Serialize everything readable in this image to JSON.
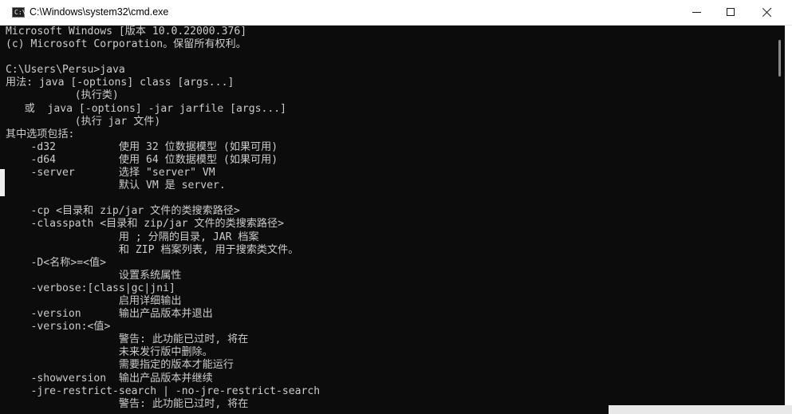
{
  "window": {
    "title": "C:\\Windows\\system32\\cmd.exe",
    "icon": "cmd-icon",
    "icon_prompt": "C:\\"
  },
  "controls": {
    "minimize": "minimize-icon",
    "maximize": "maximize-icon",
    "close": "close-icon"
  },
  "colors": {
    "console_bg": "#0c0c0c",
    "console_text": "#cccccc",
    "titlebar_bg": "#ffffff"
  },
  "console": {
    "lines": [
      "Microsoft Windows [版本 10.0.22000.376]",
      "(c) Microsoft Corporation。保留所有权利。",
      "",
      "C:\\Users\\Persu>java",
      "用法: java [-options] class [args...]",
      "           (执行类)",
      "   或  java [-options] -jar jarfile [args...]",
      "           (执行 jar 文件)",
      "其中选项包括:",
      "    -d32          使用 32 位数据模型 (如果可用)",
      "    -d64          使用 64 位数据模型 (如果可用)",
      "    -server       选择 \"server\" VM",
      "                  默认 VM 是 server.",
      "",
      "    -cp <目录和 zip/jar 文件的类搜索路径>",
      "    -classpath <目录和 zip/jar 文件的类搜索路径>",
      "                  用 ; 分隔的目录, JAR 档案",
      "                  和 ZIP 档案列表, 用于搜索类文件。",
      "    -D<名称>=<值>",
      "                  设置系统属性",
      "    -verbose:[class|gc|jni]",
      "                  启用详细输出",
      "    -version      输出产品版本并退出",
      "    -version:<值>",
      "                  警告: 此功能已过时, 将在",
      "                  未来发行版中删除。",
      "                  需要指定的版本才能运行",
      "    -showversion  输出产品版本并继续",
      "    -jre-restrict-search | -no-jre-restrict-search",
      "                  警告: 此功能已过时, 将在"
    ]
  }
}
